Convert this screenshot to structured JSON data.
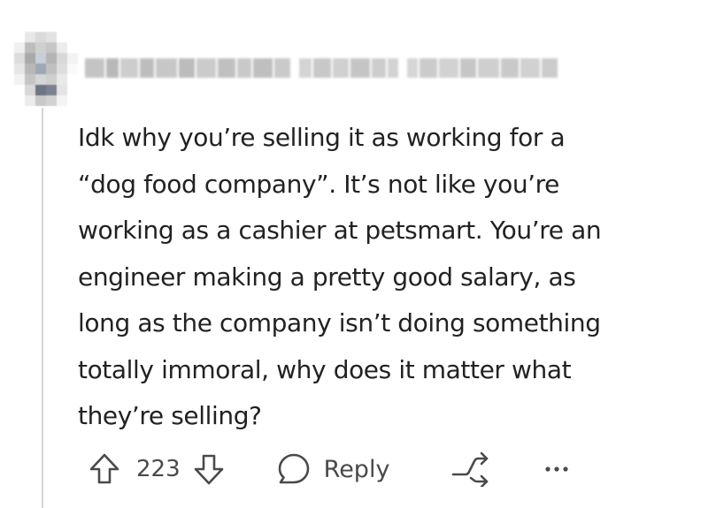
{
  "comment": {
    "author_redacted": true,
    "body": "Idk why you’re selling it as working for a\n“dog food company”. It’s not like you’re\nworking as a cashier at petsmart. You’re an\nengineer making a pretty good salary, as\nlong as the company isn’t doing something\ntotally immoral, why does it matter what\nthey’re selling?"
  },
  "actions": {
    "upvote_icon": "arrow-up-outline-icon",
    "vote_count": "223",
    "downvote_icon": "arrow-down-outline-icon",
    "reply_icon": "speech-bubble-icon",
    "reply_label": "Reply",
    "share_icon": "share-arrow-icon",
    "more_icon": "more-horizontal-icon"
  },
  "colors": {
    "text": "#222222",
    "muted": "#4a4a4a",
    "thread_line": "#d6d6d6",
    "background": "#ffffff"
  }
}
